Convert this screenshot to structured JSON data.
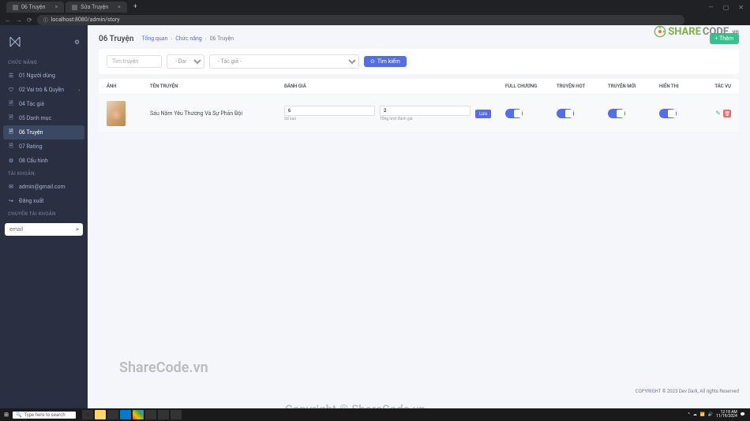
{
  "browser": {
    "tabs": [
      {
        "label": "06 Truyện"
      },
      {
        "label": "Sửa Truyện"
      }
    ],
    "url": "localhost:8080/admin/story",
    "window": {
      "min": "—",
      "max": "▢",
      "close": "✕"
    }
  },
  "sidebar": {
    "sections": {
      "chucnang_label": "CHỨC NĂNG",
      "taikhoan_label": "TÀI KHOẢN:",
      "chuyen_label": "CHUYỂN TÀI KHOẢN"
    },
    "items": [
      {
        "label": "01 Người dùng",
        "icon": "users"
      },
      {
        "label": "02 Vai trò & Quyền",
        "icon": "shield",
        "expand": true
      },
      {
        "label": "04 Tác giả",
        "icon": "doc"
      },
      {
        "label": "05 Danh mục",
        "icon": "invoice"
      },
      {
        "label": "06 Truyện",
        "icon": "file",
        "active": true
      },
      {
        "label": "07 Rating",
        "icon": "doc"
      },
      {
        "label": "08 Cấu hình",
        "icon": "gear"
      }
    ],
    "account_items": [
      {
        "label": "admin@gmail.com",
        "icon": "mail"
      },
      {
        "label": "Đăng xuất",
        "icon": "logout"
      }
    ],
    "email_placeholder": "email"
  },
  "page": {
    "title": "06 Truyện",
    "breadcrumb": [
      "Tổng quan",
      "Chức năng",
      "06 Truyện"
    ],
    "add_label": "+ Thêm"
  },
  "filters": {
    "search_placeholder": "Tìm truyện",
    "cat_placeholder": "- Danh mục -",
    "author_placeholder": "- Tác giả -",
    "search_btn": "Tìm kiếm"
  },
  "table": {
    "headers": {
      "anh": "ẢNH",
      "ten": "TÊN TRUYỆN",
      "danhgia": "ĐÁNH GIÁ",
      "full": "FULL CHƯƠNG",
      "hot": "TRUYỆN HOT",
      "moi": "TRUYỆN MỚI",
      "hien": "HIỂN THỊ",
      "tacvu": "TÁC VỤ"
    },
    "rows": [
      {
        "name": "Sáu Năm Yêu Thương Và Sự Phản Bội",
        "rate1": "6",
        "rate1_label": "Số sao",
        "rate2": "2",
        "rate2_label": "Tổng lượt đánh giá",
        "save": "Lưu"
      }
    ]
  },
  "footer": "COPYRIGHT © 2023 Dev Dark, All rights Reserved",
  "watermarks": {
    "w1": "ShareCode.vn",
    "w2": "Copyright © ShareCode.vn",
    "logo_share": "SHARE",
    "logo_code": "CODE",
    "logo_vn": ".vn"
  },
  "taskbar": {
    "search": "Type here to search",
    "time": "12:18 AM",
    "date": "11/19/2024"
  }
}
